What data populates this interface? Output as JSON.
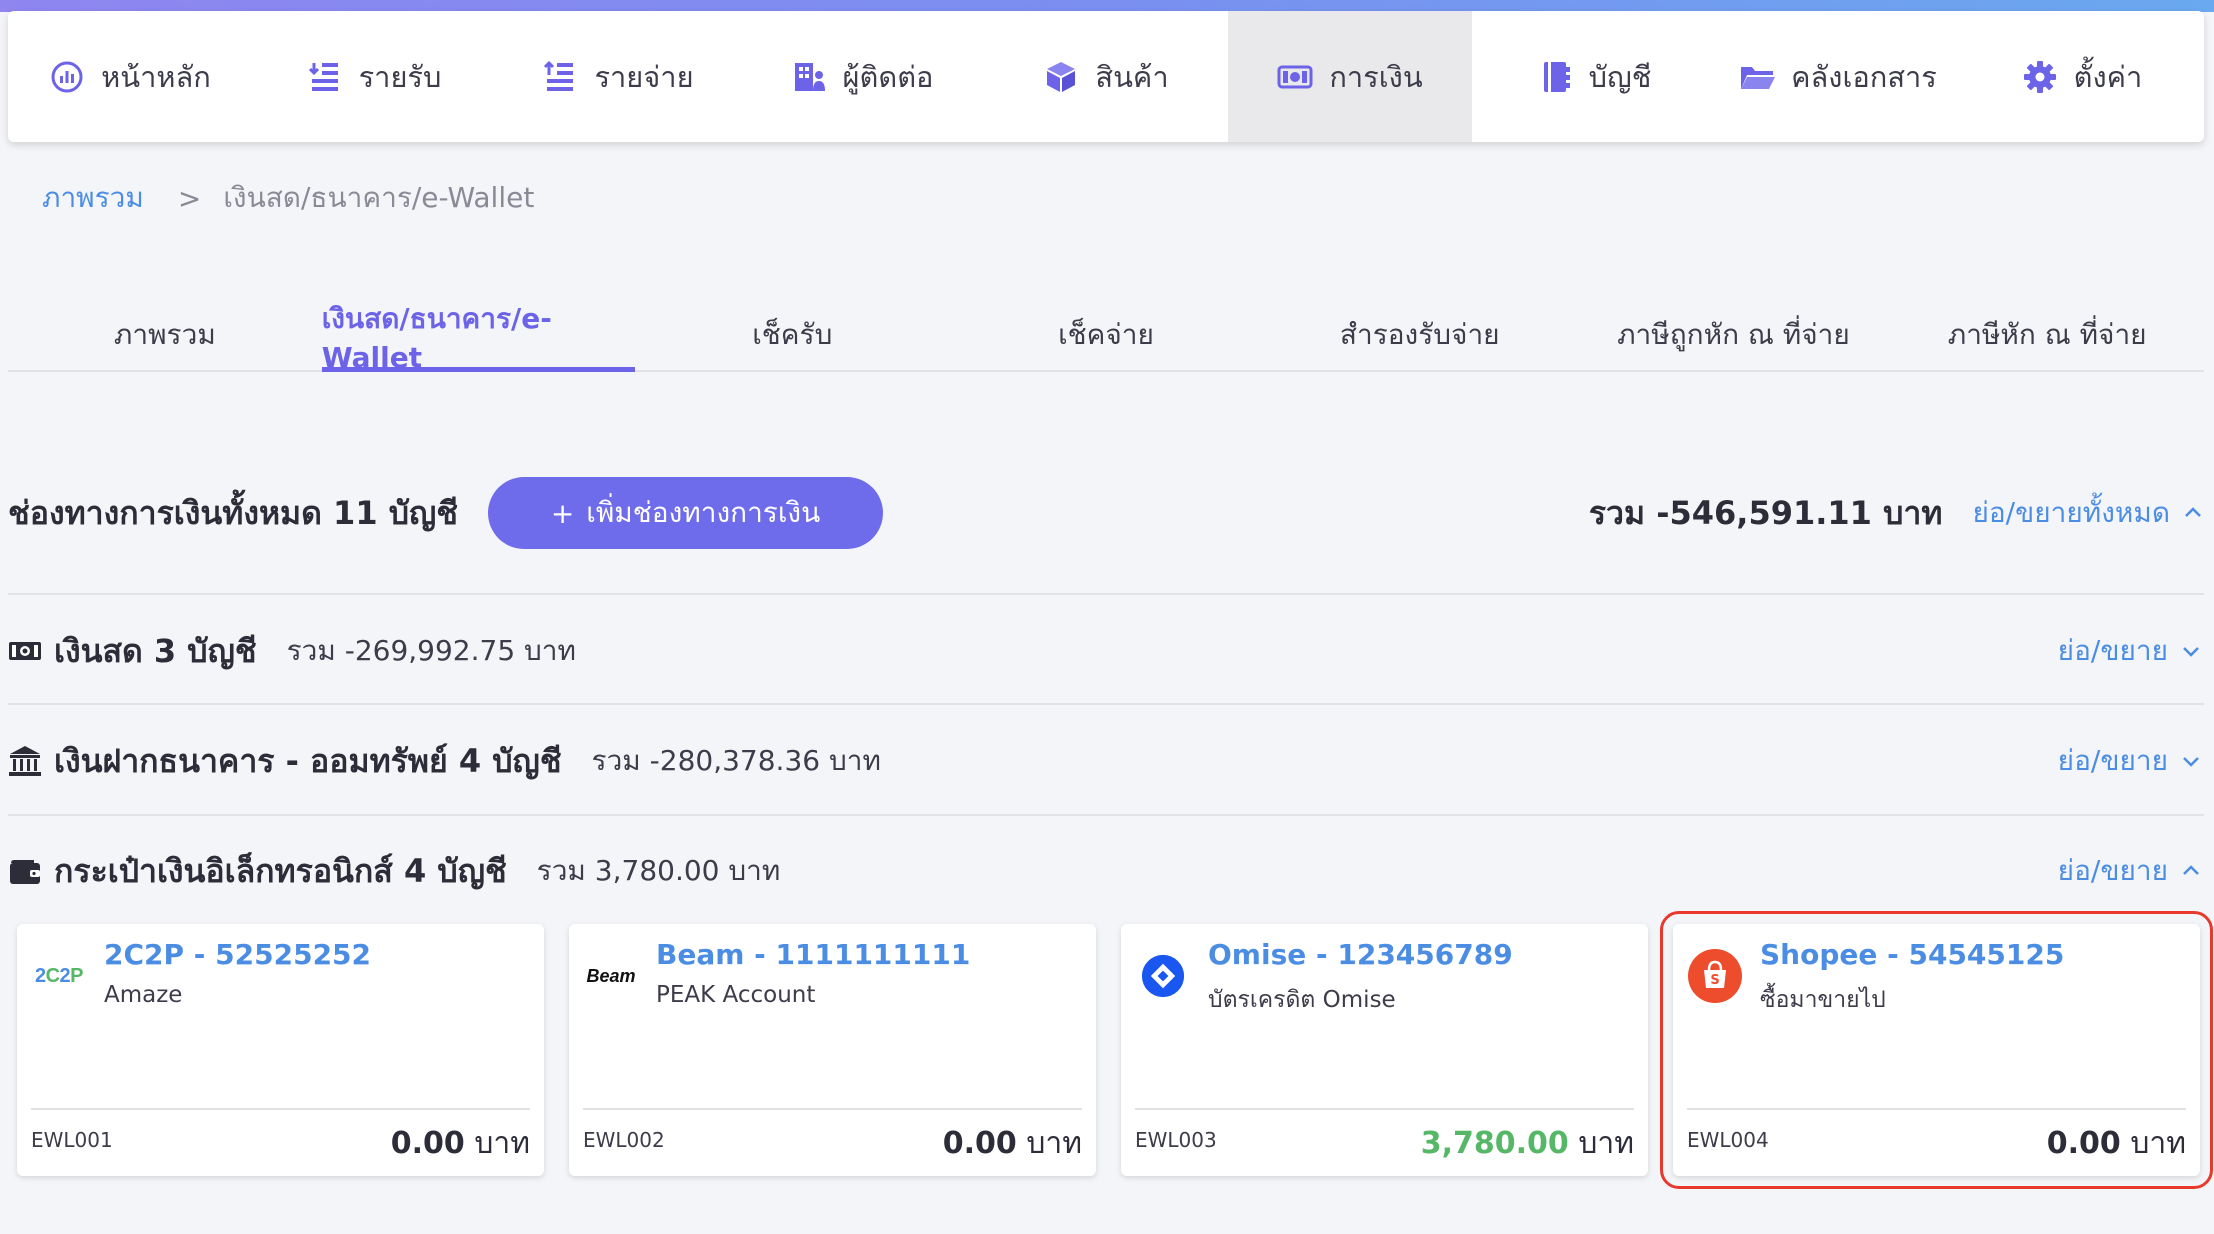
{
  "colors": {
    "accent": "#6c63e8",
    "link": "#4c8de4",
    "button": "#6e6cea",
    "positive": "#56b867",
    "highlight_border": "#e8392c",
    "shopee": "#ee4d2d",
    "omise": "#1a56f0"
  },
  "nav": {
    "items": [
      {
        "label": "หน้าหลัก",
        "icon": "dashboard-icon"
      },
      {
        "label": "รายรับ",
        "icon": "income-list-icon"
      },
      {
        "label": "รายจ่าย",
        "icon": "expense-list-icon"
      },
      {
        "label": "ผู้ติดต่อ",
        "icon": "contacts-building-icon"
      },
      {
        "label": "สินค้า",
        "icon": "product-box-icon"
      },
      {
        "label": "การเงิน",
        "icon": "money-bill-icon",
        "active": true
      },
      {
        "label": "บัญชี",
        "icon": "ledger-book-icon"
      },
      {
        "label": "คลังเอกสาร",
        "icon": "folder-open-icon"
      },
      {
        "label": "ตั้งค่า",
        "icon": "gear-icon"
      }
    ]
  },
  "breadcrumb": {
    "root": "ภาพรวม",
    "separator": ">",
    "current": "เงินสด/ธนาคาร/e-Wallet"
  },
  "tabs": [
    {
      "label": "ภาพรวม"
    },
    {
      "label": "เงินสด/ธนาคาร/e-Wallet",
      "active": true
    },
    {
      "label": "เช็ครับ"
    },
    {
      "label": "เช็คจ่าย"
    },
    {
      "label": "สำรองรับจ่าย"
    },
    {
      "label": "ภาษีถูกหัก ณ ที่จ่าย"
    },
    {
      "label": "ภาษีหัก ณ ที่จ่าย"
    }
  ],
  "summary": {
    "title": "ช่องทางการเงินทั้งหมด 11 บัญชี",
    "add_button_plus": "+",
    "add_button_label": "เพิ่มช่องทางการเงิน",
    "total": "รวม -546,591.11 บาท",
    "toggle_all": "ย่อ/ขยายทั้งหมด"
  },
  "groups": [
    {
      "title": "เงินสด 3 บัญชี",
      "sum": "รวม -269,992.75 บาท",
      "toggle": "ย่อ/ขยาย",
      "icon": "cash-icon",
      "expanded": false
    },
    {
      "title": "เงินฝากธนาคาร - ออมทรัพย์ 4 บัญชี",
      "sum": "รวม -280,378.36 บาท",
      "toggle": "ย่อ/ขยาย",
      "icon": "bank-icon",
      "expanded": false
    },
    {
      "title": "กระเป๋าเงินอิเล็กทรอนิกส์ 4 บัญชี",
      "sum": "รวม 3,780.00 บาท",
      "toggle": "ย่อ/ขยาย",
      "icon": "wallet-icon",
      "expanded": true
    }
  ],
  "wallets": [
    {
      "logo_text": "2C2P",
      "name": "2C2P - 52525252",
      "desc": "Amaze",
      "code": "EWL001",
      "amount": "0.00",
      "unit": "บาท"
    },
    {
      "logo_text": "Beam",
      "name": "Beam - 1111111111",
      "desc": "PEAK Account",
      "code": "EWL002",
      "amount": "0.00",
      "unit": "บาท"
    },
    {
      "name": "Omise - 123456789",
      "desc": "บัตรเครดิต Omise",
      "code": "EWL003",
      "amount": "3,780.00",
      "unit": "บาท"
    },
    {
      "name": "Shopee - 54545125",
      "desc": "ซื้อมาขายไป",
      "code": "EWL004",
      "amount": "0.00",
      "unit": "บาท",
      "highlighted": true
    }
  ]
}
